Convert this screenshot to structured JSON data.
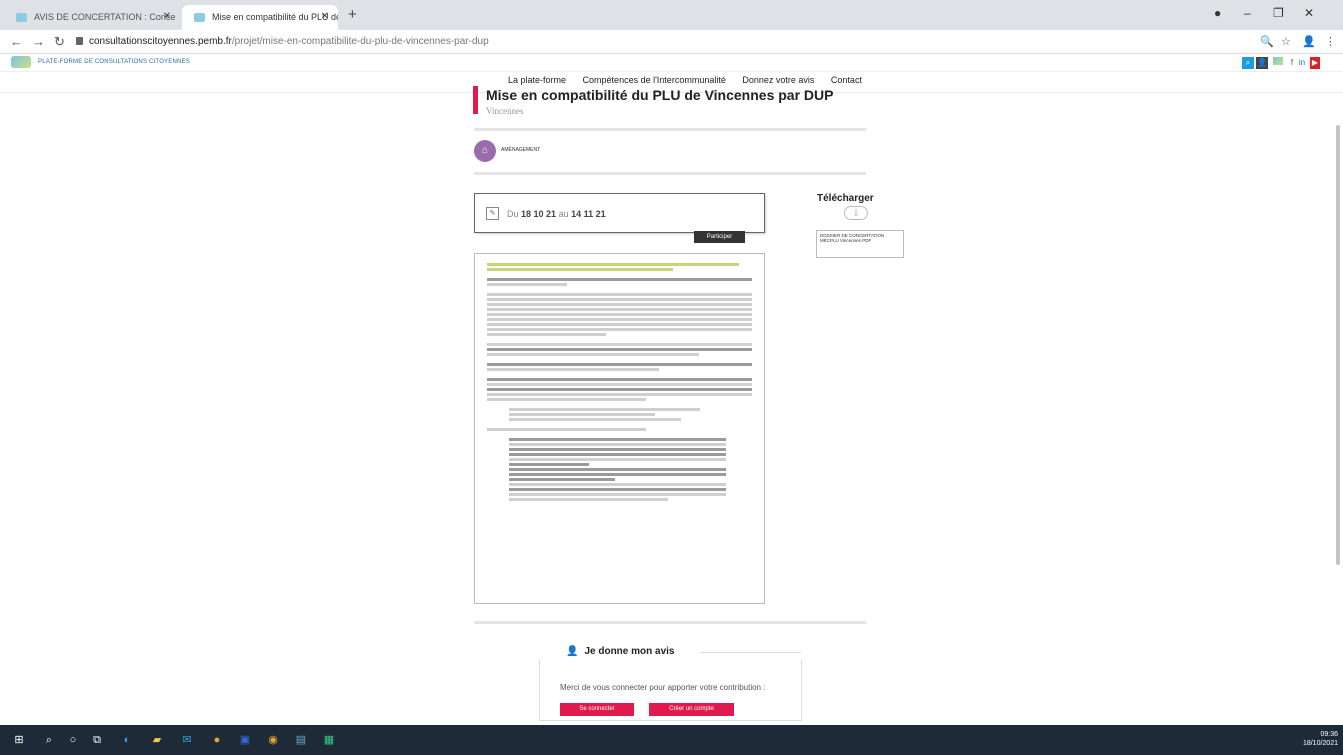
{
  "browser": {
    "tabs": [
      {
        "label": "AVIS DE CONCERTATION : Conce"
      },
      {
        "label": "Mise en compatibilité du PLU de"
      }
    ],
    "url_host": "consultationscitoyennes.pemb.fr",
    "url_path": "/projet/mise-en-compatibilite-du-plu-de-vincennes-par-dup"
  },
  "site": {
    "name": "PLATE-FORME DE CONSULTATIONS CITOYENNES",
    "nav": [
      "La plate-forme",
      "Compétences de l'Intercommunalité",
      "Donnez votre avis",
      "Contact"
    ]
  },
  "project": {
    "title": "Mise en compatibilité du PLU de Vincennes par DUP",
    "city": "Vincennes",
    "tag": "AMÉNAGEMENT",
    "date_prefix": "Du",
    "date_start": "18 10 21",
    "date_sep": "au",
    "date_end": "14 11 21",
    "participate_label": "Participer"
  },
  "download": {
    "title": "Télécharger",
    "file_label": "DOSSIER DE CONCERTATION MECPLU Vincennes.PDF"
  },
  "avis": {
    "title": "Je donne mon avis",
    "text": "Merci de vous connecter pour apporter votre contribution :",
    "login_label": "Se connecter",
    "create_label": "Créer un compte"
  },
  "taskbar": {
    "time": "09:36",
    "date": "18/10/2021"
  },
  "colors": {
    "accent": "#e01a4f",
    "tag": "#9b6cab",
    "taskbar": "#1f2a38"
  }
}
